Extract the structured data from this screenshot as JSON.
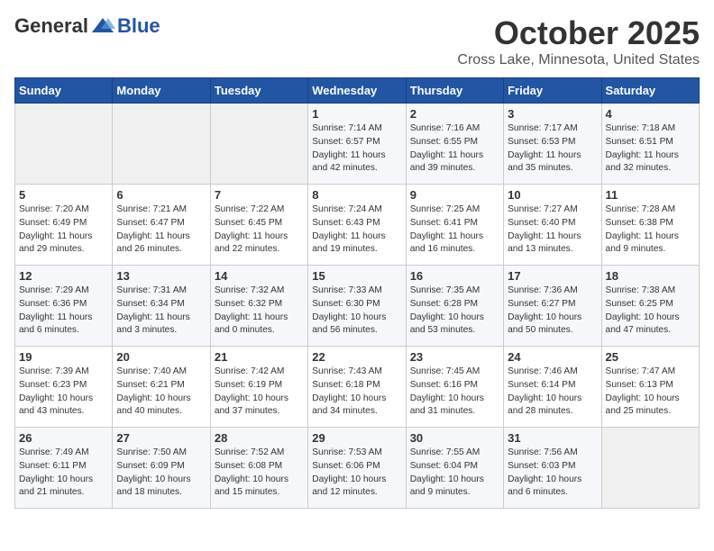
{
  "logo": {
    "general": "General",
    "blue": "Blue"
  },
  "title": "October 2025",
  "subtitle": "Cross Lake, Minnesota, United States",
  "days_of_week": [
    "Sunday",
    "Monday",
    "Tuesday",
    "Wednesday",
    "Thursday",
    "Friday",
    "Saturday"
  ],
  "weeks": [
    [
      {
        "day": "",
        "info": ""
      },
      {
        "day": "",
        "info": ""
      },
      {
        "day": "",
        "info": ""
      },
      {
        "day": "1",
        "info": "Sunrise: 7:14 AM\nSunset: 6:57 PM\nDaylight: 11 hours\nand 42 minutes."
      },
      {
        "day": "2",
        "info": "Sunrise: 7:16 AM\nSunset: 6:55 PM\nDaylight: 11 hours\nand 39 minutes."
      },
      {
        "day": "3",
        "info": "Sunrise: 7:17 AM\nSunset: 6:53 PM\nDaylight: 11 hours\nand 35 minutes."
      },
      {
        "day": "4",
        "info": "Sunrise: 7:18 AM\nSunset: 6:51 PM\nDaylight: 11 hours\nand 32 minutes."
      }
    ],
    [
      {
        "day": "5",
        "info": "Sunrise: 7:20 AM\nSunset: 6:49 PM\nDaylight: 11 hours\nand 29 minutes."
      },
      {
        "day": "6",
        "info": "Sunrise: 7:21 AM\nSunset: 6:47 PM\nDaylight: 11 hours\nand 26 minutes."
      },
      {
        "day": "7",
        "info": "Sunrise: 7:22 AM\nSunset: 6:45 PM\nDaylight: 11 hours\nand 22 minutes."
      },
      {
        "day": "8",
        "info": "Sunrise: 7:24 AM\nSunset: 6:43 PM\nDaylight: 11 hours\nand 19 minutes."
      },
      {
        "day": "9",
        "info": "Sunrise: 7:25 AM\nSunset: 6:41 PM\nDaylight: 11 hours\nand 16 minutes."
      },
      {
        "day": "10",
        "info": "Sunrise: 7:27 AM\nSunset: 6:40 PM\nDaylight: 11 hours\nand 13 minutes."
      },
      {
        "day": "11",
        "info": "Sunrise: 7:28 AM\nSunset: 6:38 PM\nDaylight: 11 hours\nand 9 minutes."
      }
    ],
    [
      {
        "day": "12",
        "info": "Sunrise: 7:29 AM\nSunset: 6:36 PM\nDaylight: 11 hours\nand 6 minutes."
      },
      {
        "day": "13",
        "info": "Sunrise: 7:31 AM\nSunset: 6:34 PM\nDaylight: 11 hours\nand 3 minutes."
      },
      {
        "day": "14",
        "info": "Sunrise: 7:32 AM\nSunset: 6:32 PM\nDaylight: 11 hours\nand 0 minutes."
      },
      {
        "day": "15",
        "info": "Sunrise: 7:33 AM\nSunset: 6:30 PM\nDaylight: 10 hours\nand 56 minutes."
      },
      {
        "day": "16",
        "info": "Sunrise: 7:35 AM\nSunset: 6:28 PM\nDaylight: 10 hours\nand 53 minutes."
      },
      {
        "day": "17",
        "info": "Sunrise: 7:36 AM\nSunset: 6:27 PM\nDaylight: 10 hours\nand 50 minutes."
      },
      {
        "day": "18",
        "info": "Sunrise: 7:38 AM\nSunset: 6:25 PM\nDaylight: 10 hours\nand 47 minutes."
      }
    ],
    [
      {
        "day": "19",
        "info": "Sunrise: 7:39 AM\nSunset: 6:23 PM\nDaylight: 10 hours\nand 43 minutes."
      },
      {
        "day": "20",
        "info": "Sunrise: 7:40 AM\nSunset: 6:21 PM\nDaylight: 10 hours\nand 40 minutes."
      },
      {
        "day": "21",
        "info": "Sunrise: 7:42 AM\nSunset: 6:19 PM\nDaylight: 10 hours\nand 37 minutes."
      },
      {
        "day": "22",
        "info": "Sunrise: 7:43 AM\nSunset: 6:18 PM\nDaylight: 10 hours\nand 34 minutes."
      },
      {
        "day": "23",
        "info": "Sunrise: 7:45 AM\nSunset: 6:16 PM\nDaylight: 10 hours\nand 31 minutes."
      },
      {
        "day": "24",
        "info": "Sunrise: 7:46 AM\nSunset: 6:14 PM\nDaylight: 10 hours\nand 28 minutes."
      },
      {
        "day": "25",
        "info": "Sunrise: 7:47 AM\nSunset: 6:13 PM\nDaylight: 10 hours\nand 25 minutes."
      }
    ],
    [
      {
        "day": "26",
        "info": "Sunrise: 7:49 AM\nSunset: 6:11 PM\nDaylight: 10 hours\nand 21 minutes."
      },
      {
        "day": "27",
        "info": "Sunrise: 7:50 AM\nSunset: 6:09 PM\nDaylight: 10 hours\nand 18 minutes."
      },
      {
        "day": "28",
        "info": "Sunrise: 7:52 AM\nSunset: 6:08 PM\nDaylight: 10 hours\nand 15 minutes."
      },
      {
        "day": "29",
        "info": "Sunrise: 7:53 AM\nSunset: 6:06 PM\nDaylight: 10 hours\nand 12 minutes."
      },
      {
        "day": "30",
        "info": "Sunrise: 7:55 AM\nSunset: 6:04 PM\nDaylight: 10 hours\nand 9 minutes."
      },
      {
        "day": "31",
        "info": "Sunrise: 7:56 AM\nSunset: 6:03 PM\nDaylight: 10 hours\nand 6 minutes."
      },
      {
        "day": "",
        "info": ""
      }
    ]
  ]
}
